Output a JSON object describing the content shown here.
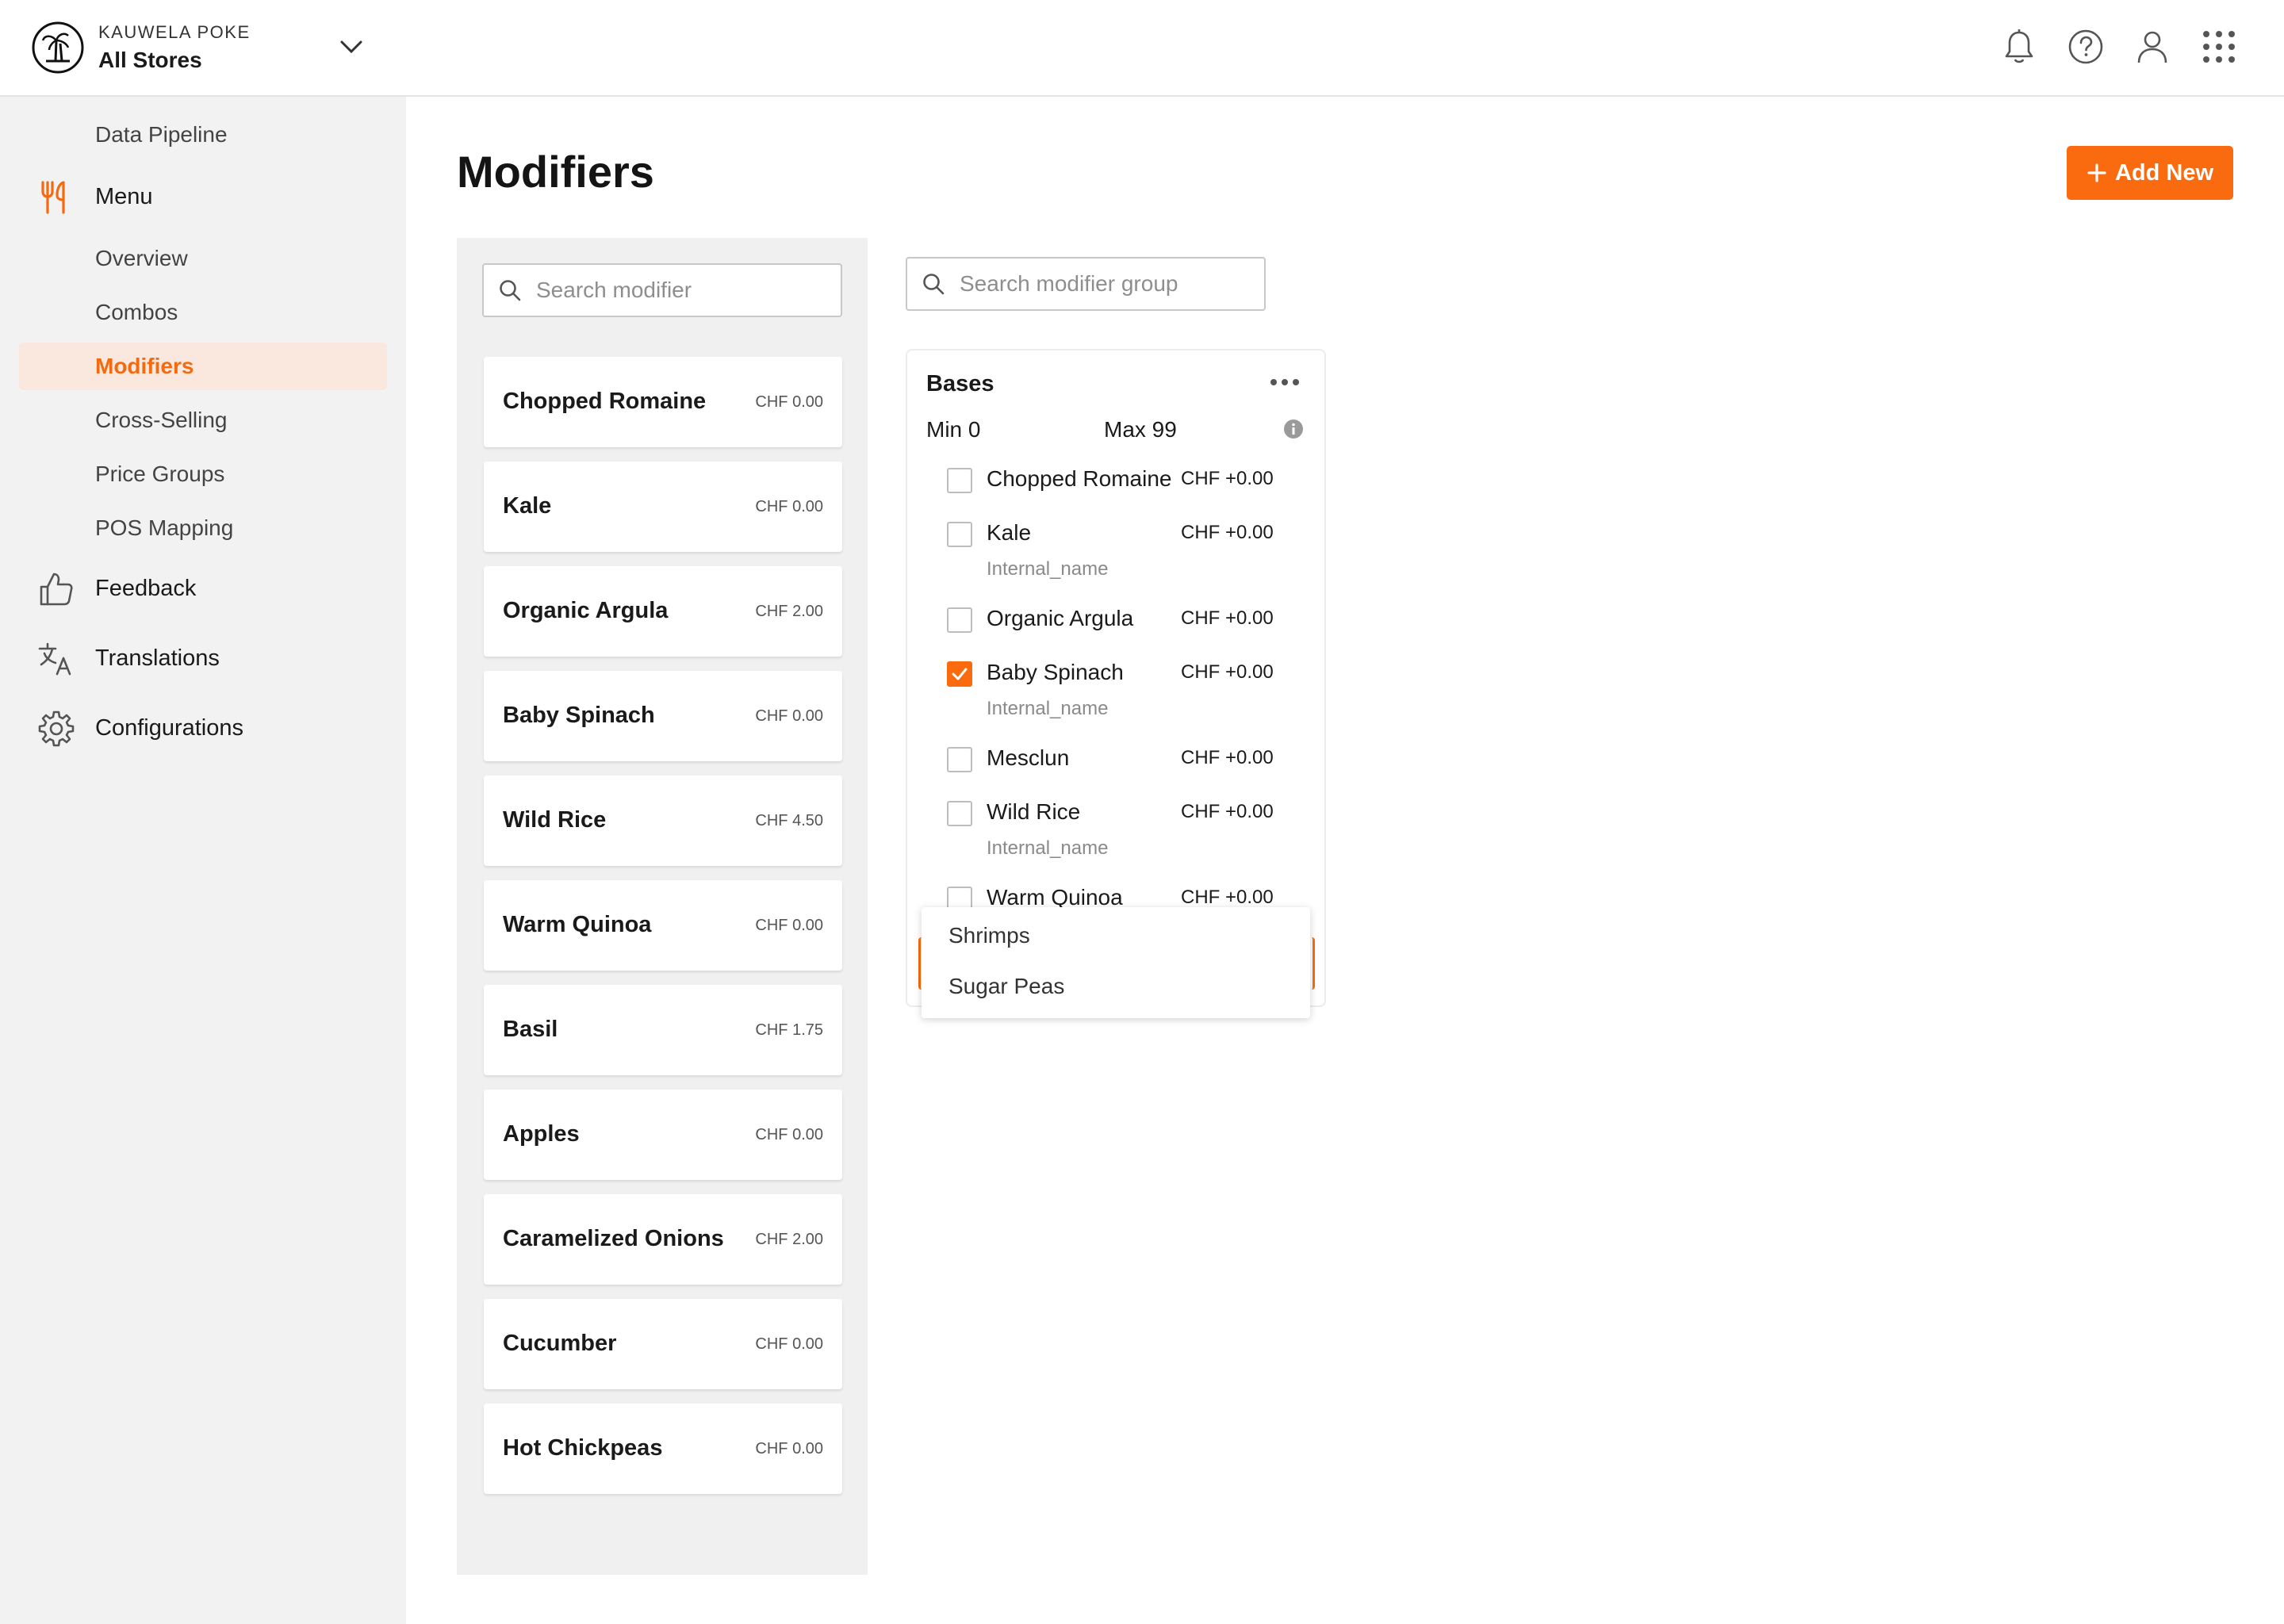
{
  "header": {
    "brand_sub": "KAUWELA POKE",
    "brand_main": "All Stores",
    "icons": [
      "bell-icon",
      "help-icon",
      "user-icon",
      "apps-grid-icon"
    ]
  },
  "sidebar": {
    "data_pipeline": "Data Pipeline",
    "menu": "Menu",
    "overview": "Overview",
    "combos": "Combos",
    "modifiers": "Modifiers",
    "cross_selling": "Cross-Selling",
    "price_groups": "Price Groups",
    "pos_mapping": "POS Mapping",
    "feedback": "Feedback",
    "translations": "Translations",
    "configurations": "Configurations"
  },
  "page": {
    "title": "Modifiers",
    "add_button": "Add New"
  },
  "modifier_search": {
    "placeholder": "Search modifier"
  },
  "modifiers": [
    {
      "name": "Chopped Romaine",
      "price": "CHF 0.00"
    },
    {
      "name": "Kale",
      "price": "CHF 0.00"
    },
    {
      "name": "Organic Argula",
      "price": "CHF 2.00"
    },
    {
      "name": "Baby Spinach",
      "price": "CHF 0.00"
    },
    {
      "name": "Wild Rice",
      "price": "CHF 4.50"
    },
    {
      "name": "Warm Quinoa",
      "price": "CHF 0.00"
    },
    {
      "name": "Basil",
      "price": "CHF 1.75"
    },
    {
      "name": "Apples",
      "price": "CHF 0.00"
    },
    {
      "name": "Caramelized Onions",
      "price": "CHF 2.00"
    },
    {
      "name": "Cucumber",
      "price": "CHF 0.00"
    },
    {
      "name": "Hot Chickpeas",
      "price": "CHF 0.00"
    }
  ],
  "group_search": {
    "placeholder": "Search modifier group"
  },
  "group": {
    "title": "Bases",
    "min": "Min 0",
    "max": "Max 99",
    "options": [
      {
        "name": "Chopped Romaine",
        "price": "CHF +0.00",
        "internal": "",
        "checked": false
      },
      {
        "name": "Kale",
        "price": "CHF +0.00",
        "internal": "Internal_name",
        "checked": false
      },
      {
        "name": "Organic Argula",
        "price": "CHF +0.00",
        "internal": "",
        "checked": false
      },
      {
        "name": "Baby Spinach",
        "price": "CHF +0.00",
        "internal": "Internal_name",
        "checked": true
      },
      {
        "name": "Mesclun",
        "price": "CHF +0.00",
        "internal": "",
        "checked": false
      },
      {
        "name": "Wild Rice",
        "price": "CHF +0.00",
        "internal": "Internal_name",
        "checked": false
      },
      {
        "name": "Warm Quinoa",
        "price": "CHF +0.00",
        "internal": "",
        "checked": false
      }
    ]
  },
  "dropdown": {
    "items": [
      "Shrimps",
      "Sugar Peas"
    ]
  },
  "colors": {
    "accent": "#f96b0e",
    "active_nav_bg": "#fae8df",
    "sidebar_bg": "#f2f2f2"
  }
}
